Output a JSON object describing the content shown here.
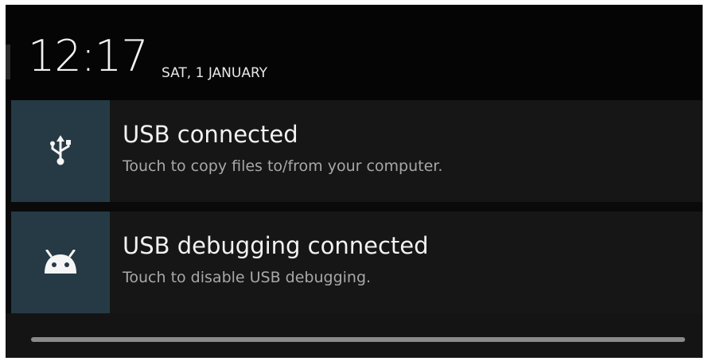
{
  "status_header": {
    "time": "12:17",
    "date": "SAT, 1 JANUARY"
  },
  "notifications": [
    {
      "icon": "usb-icon",
      "title": "USB connected",
      "text": "Touch to copy files to/from your computer."
    },
    {
      "icon": "android-icon",
      "title": "USB debugging connected",
      "text": "Touch to disable USB debugging."
    }
  ],
  "colors": {
    "background": "#0a0a0a",
    "card": "#161616",
    "icon_tile": "#253a45",
    "title_text": "#f2f2f2",
    "body_text": "#a8a8a8",
    "handle": "#8a8a8a"
  }
}
